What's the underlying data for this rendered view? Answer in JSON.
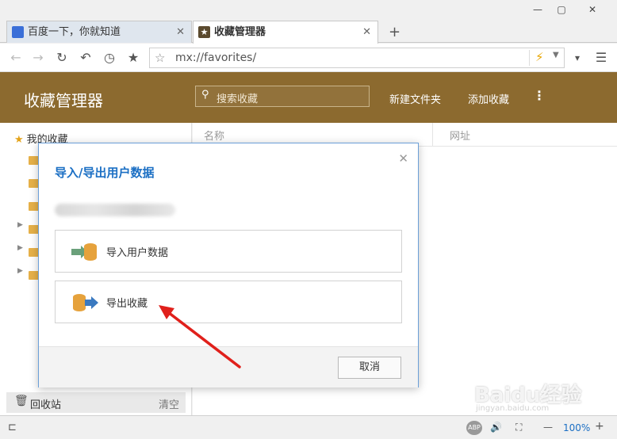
{
  "window": {
    "minimize": "—",
    "restore": "▢",
    "close": "✕"
  },
  "tabs": [
    {
      "label": "百度一下，你就知道",
      "close": "✕",
      "active": false
    },
    {
      "label": "收藏管理器",
      "close": "✕",
      "active": true
    }
  ],
  "new_tab": "+",
  "nav": {
    "back": "←",
    "forward": "→",
    "reload": "↻",
    "undo": "↶",
    "history": "◷",
    "bookmark": "★",
    "url_star": "☆",
    "url": "mx://favorites/",
    "bolt": "⚡",
    "dropdown": "▼",
    "menu_down": "▾",
    "menu": "☰"
  },
  "header": {
    "title": "收藏管理器",
    "search_placeholder": "搜索收藏",
    "new_folder": "新建文件夹",
    "add_favorite": "添加收藏",
    "more": "⋮"
  },
  "sidebar": {
    "root_label": "我的收藏",
    "recycle_label": "回收站",
    "recycle_clear": "清空"
  },
  "columns": {
    "name": "名称",
    "url": "网址"
  },
  "dialog": {
    "title": "导入/导出用户数据",
    "close": "✕",
    "import_label": "导入用户数据",
    "export_label": "导出收藏",
    "cancel": "取消"
  },
  "status": {
    "zoom": "100%",
    "zoom_minus": "—",
    "zoom_plus": "+",
    "abp": "ABP"
  },
  "watermark": {
    "text": "Baidu经验",
    "sub": "jingyan.baidu.com"
  },
  "colors": {
    "header_bg": "#8c6a2f",
    "accent_blue": "#1b6fc4",
    "annotation_red": "#e0201b"
  }
}
